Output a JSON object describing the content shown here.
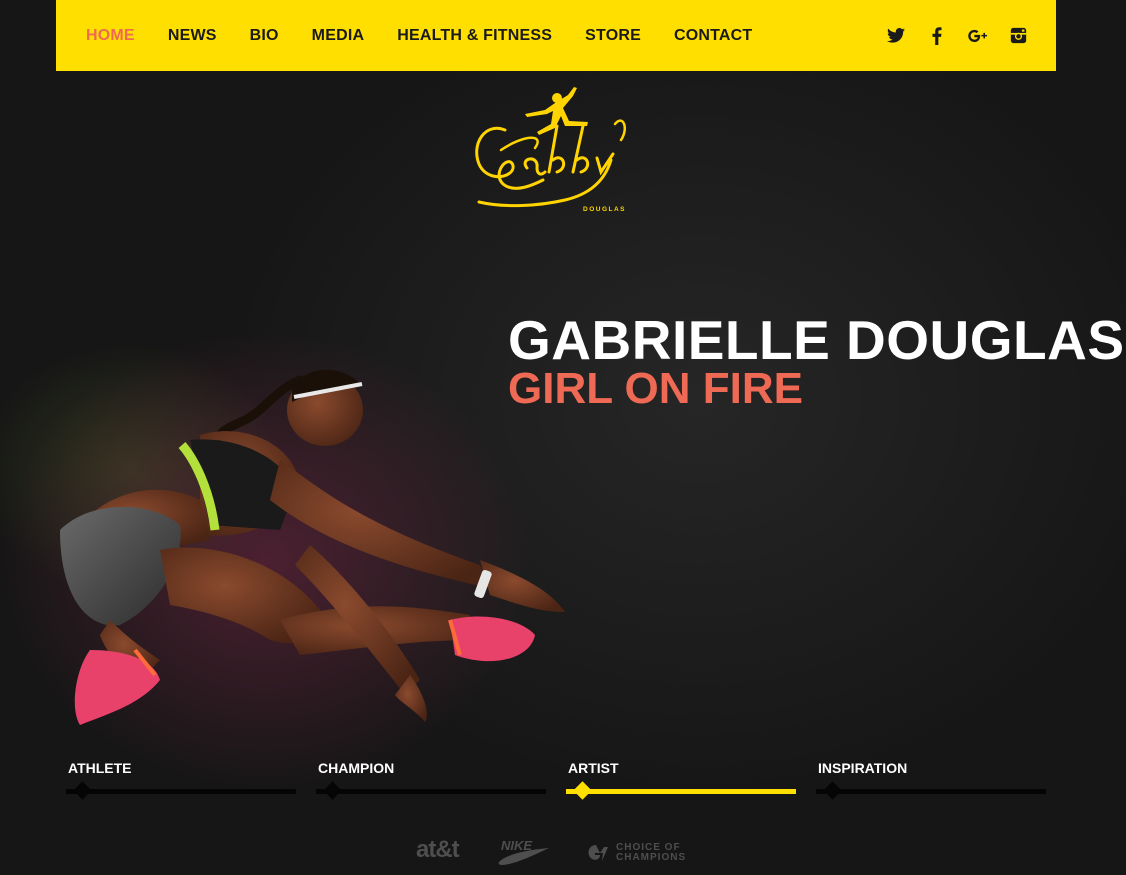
{
  "nav": {
    "items": [
      {
        "label": "HOME",
        "active": true
      },
      {
        "label": "NEWS",
        "active": false
      },
      {
        "label": "BIO",
        "active": false
      },
      {
        "label": "MEDIA",
        "active": false
      },
      {
        "label": "HEALTH & FITNESS",
        "active": false
      },
      {
        "label": "STORE",
        "active": false
      },
      {
        "label": "CONTACT",
        "active": false
      }
    ],
    "social_icons": [
      "twitter-icon",
      "facebook-icon",
      "google-plus-icon",
      "instagram-icon"
    ]
  },
  "logo": {
    "script_text": "Gabby",
    "sub_text": "DOUGLAS"
  },
  "hero": {
    "title": "GABRIELLE DOUGLAS",
    "subtitle": "GIRL ON FIRE"
  },
  "tabs": [
    {
      "label": "ATHLETE",
      "active": false
    },
    {
      "label": "CHAMPION",
      "active": false
    },
    {
      "label": "ARTIST",
      "active": true
    },
    {
      "label": "INSPIRATION",
      "active": false
    }
  ],
  "sponsors": {
    "att": "at&t",
    "nike": "NIKE",
    "coc_line1": "CHOICE OF",
    "coc_line2": "CHAMPIONS"
  },
  "colors": {
    "nav_bg": "#ffdf00",
    "accent": "#ef6a55",
    "background": "#1a1a1a"
  }
}
